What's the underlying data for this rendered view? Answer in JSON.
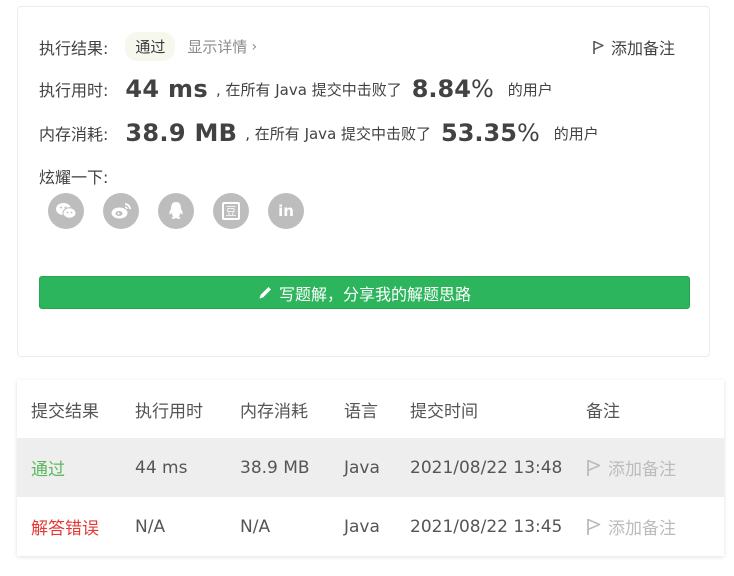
{
  "result": {
    "label": "执行结果:",
    "status": "通过",
    "details_link": "显示详情",
    "add_note": "添加备注"
  },
  "runtime": {
    "label": "执行用时:",
    "value": "44 ms",
    "mid_text": ", 在所有 Java 提交中击败了",
    "percent": "8.84",
    "percent_sign": "%",
    "suffix": "的用户"
  },
  "memory": {
    "label": "内存消耗:",
    "value": "38.9 MB",
    "mid_text": ", 在所有 Java 提交中击败了",
    "percent": "53.35",
    "percent_sign": "%",
    "suffix": "的用户"
  },
  "share": {
    "label": "炫耀一下:",
    "icons": [
      "wechat-icon",
      "weibo-icon",
      "qq-icon",
      "douban-icon",
      "linkedin-icon"
    ],
    "douban_glyph": "豆",
    "linkedin_glyph": "in"
  },
  "write_button": "写题解，分享我的解题思路",
  "table": {
    "headers": [
      "提交结果",
      "执行用时",
      "内存消耗",
      "语言",
      "提交时间",
      "备注"
    ],
    "rows": [
      {
        "result": "通过",
        "time": "44 ms",
        "memory": "38.9 MB",
        "lang": "Java",
        "submitted": "2021/08/22 13:48",
        "note": "添加备注"
      },
      {
        "result": "解答错误",
        "time": "N/A",
        "memory": "N/A",
        "lang": "Java",
        "submitted": "2021/08/22 13:45",
        "note": "添加备注"
      }
    ]
  },
  "colors": {
    "accept": "#5cb85c",
    "error": "#e53935",
    "button": "#2db55d"
  }
}
